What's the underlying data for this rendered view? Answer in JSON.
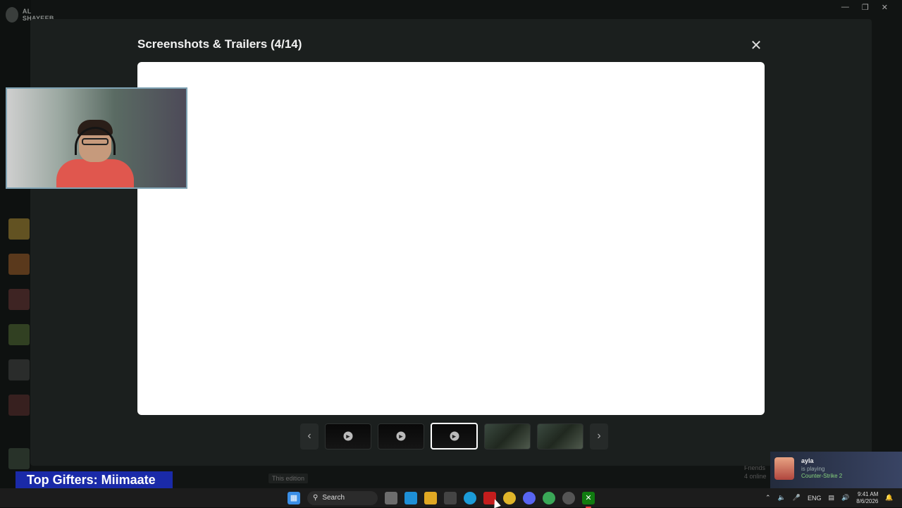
{
  "background_app": {
    "username": "AL SHAYEEB",
    "edition_tag": "This edition",
    "friends_label": "Friends",
    "friends_online": "4 online"
  },
  "modal": {
    "title": "Screenshots & Trailers (4/14)",
    "close_icon": "close-icon",
    "prev_icon": "chevron-left-icon",
    "next_icon": "chevron-right-icon",
    "prev_glyph": "‹",
    "next_glyph": "›",
    "close_glyph": "✕",
    "thumbnails": [
      {
        "kind": "trailer",
        "selected": false
      },
      {
        "kind": "trailer",
        "selected": false
      },
      {
        "kind": "trailer",
        "selected": true
      },
      {
        "kind": "screenshot",
        "selected": false
      },
      {
        "kind": "screenshot",
        "selected": false
      }
    ]
  },
  "overlay": {
    "gifters_text": "Top Gifters: Miimaate"
  },
  "toast": {
    "name": "ayla",
    "status": "is playing",
    "game": "Counter-Strike 2"
  },
  "taskbar": {
    "search_label": "Search",
    "language": "ENG",
    "time": "9:41 AM",
    "date": "8/6/2026"
  },
  "colors": {
    "modal_bg": "#1b1f1e",
    "viewer_bg": "#ffffff",
    "gifters_bg": "#1a2aa8",
    "taskbar_bg": "#1c1c1c"
  }
}
